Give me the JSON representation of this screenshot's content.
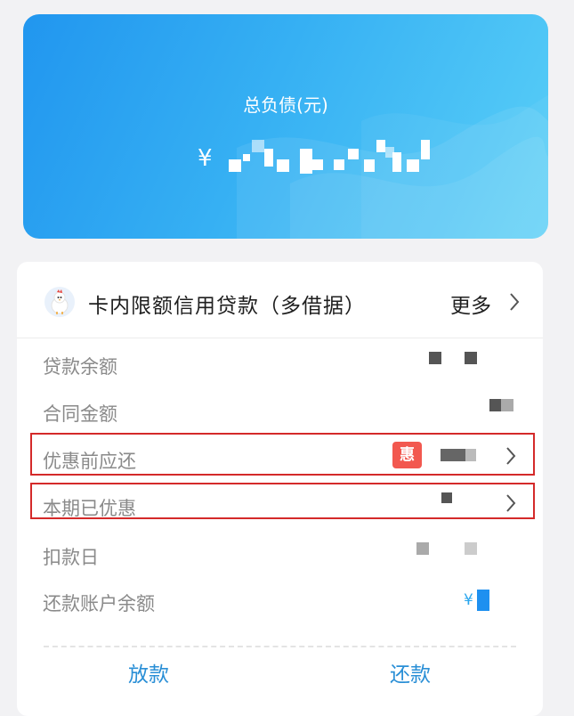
{
  "debt_summary": {
    "title": "总负债(元)",
    "currency_symbol": "¥",
    "amount_masked": true
  },
  "loan": {
    "product_icon": "chicken-mascot-icon",
    "product_name": "卡内限额信用贷款（多借据）",
    "more_label": "更多",
    "fields": [
      {
        "label": "贷款余额",
        "value_masked": true
      },
      {
        "label": "合同金额",
        "value_masked": true
      },
      {
        "label": "优惠前应还",
        "badge": "惠",
        "value_masked": true,
        "highlighted": true
      },
      {
        "label": "本期已优惠",
        "value_masked": true,
        "highlighted": true
      },
      {
        "label": "扣款日",
        "value_masked": true
      },
      {
        "label": "还款账户余额",
        "currency_symbol": "¥",
        "value_masked": true
      }
    ],
    "actions": {
      "disburse": "放款",
      "repay": "还款"
    }
  },
  "colors": {
    "card_gradient_start": "#2196ef",
    "card_gradient_end": "#59cff7",
    "highlight_border": "#d42a2a",
    "badge_red": "#f2584f",
    "action_blue": "#2a8fd6"
  }
}
